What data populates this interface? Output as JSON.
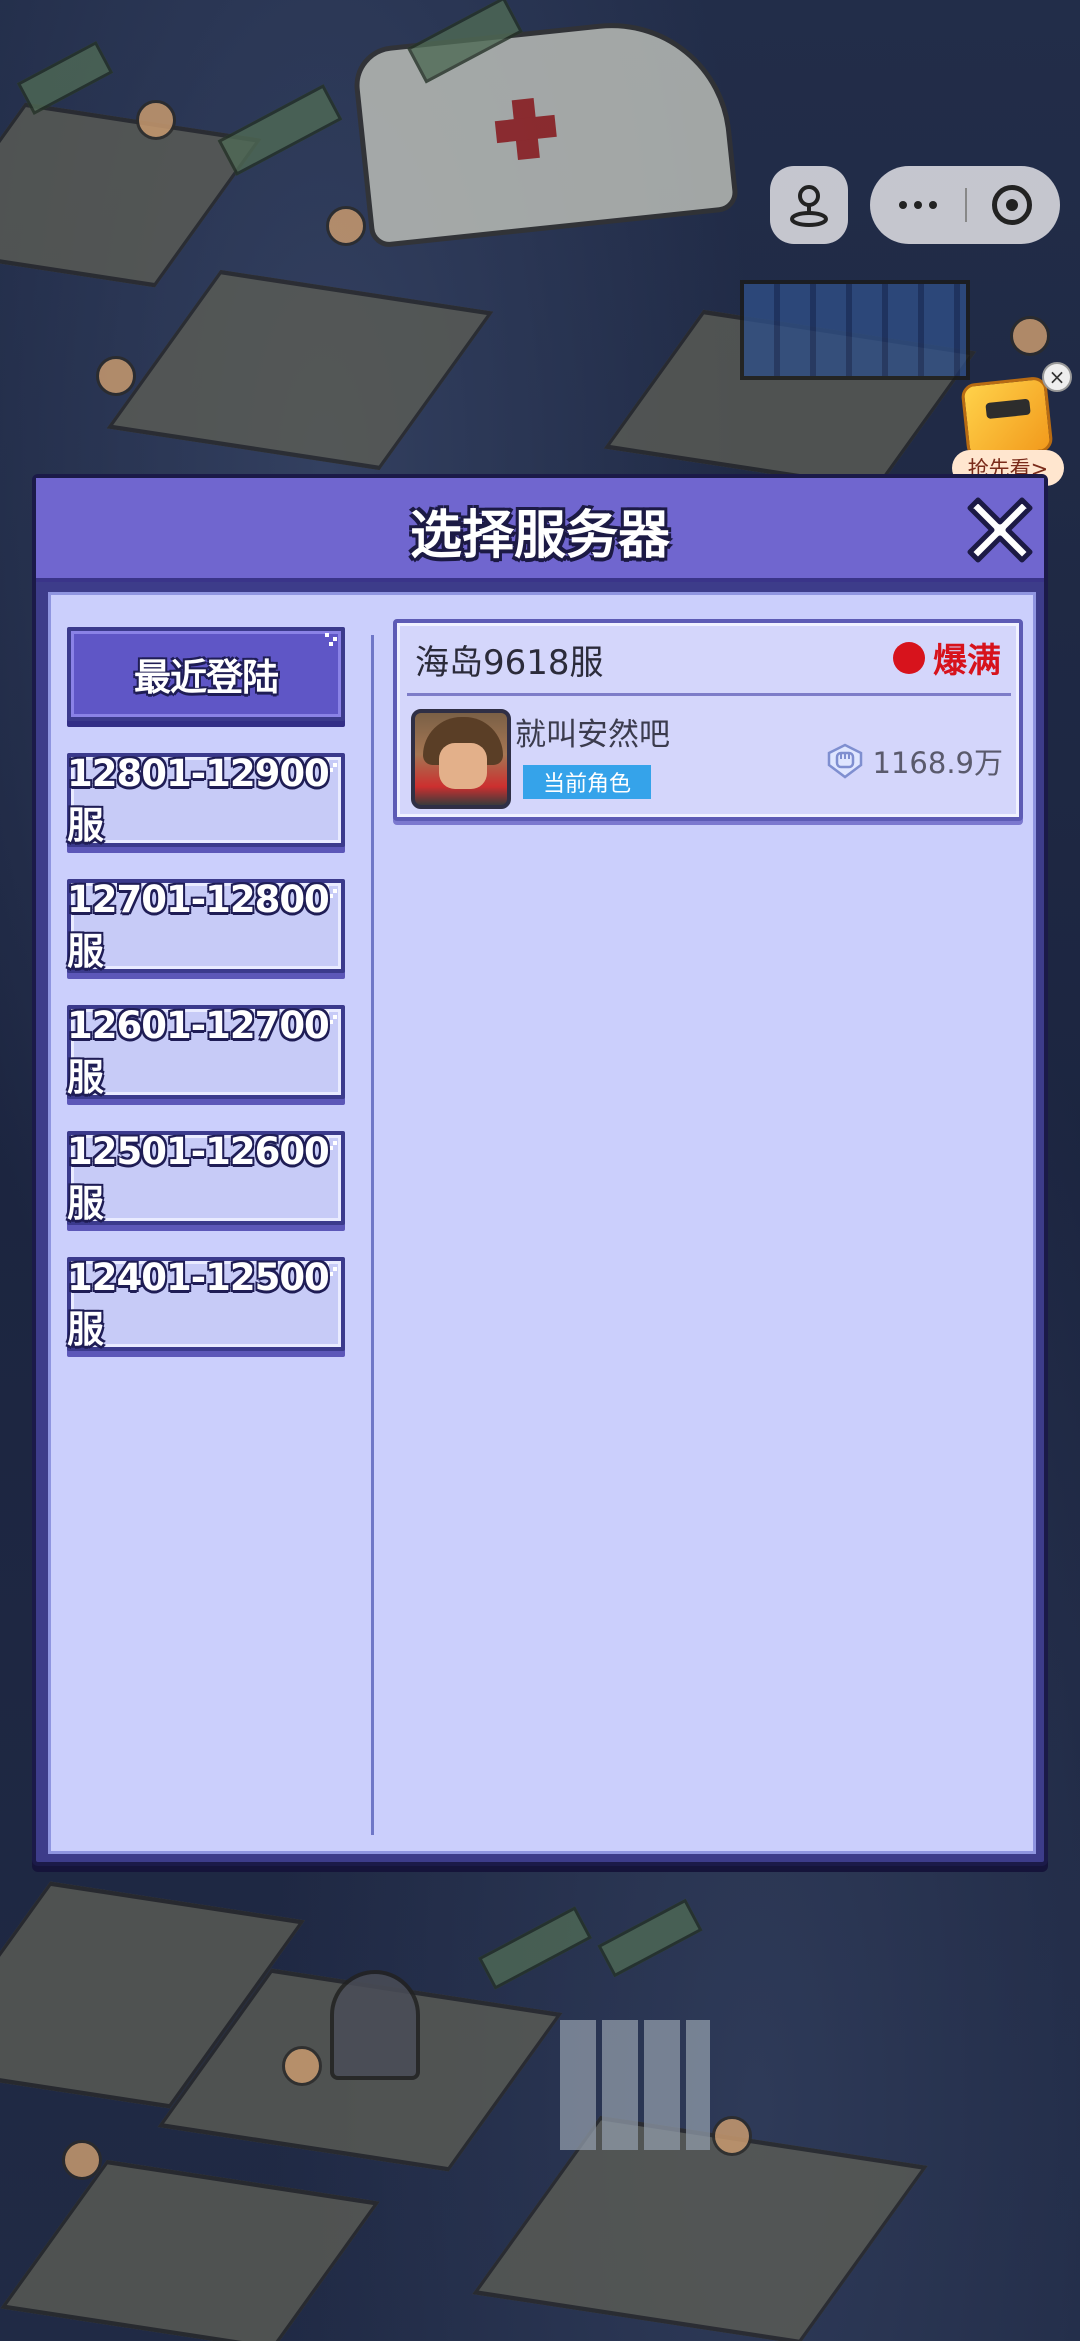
{
  "capsule": {
    "joystick_icon": "joystick-icon",
    "more_icon": "more-dots-icon",
    "close_icon": "target-circle-icon"
  },
  "promo": {
    "label": "抢先看>",
    "close_icon": "close-small-icon"
  },
  "dialog": {
    "title": "选择服务器",
    "close_icon": "close-x-icon",
    "ranges": [
      {
        "label": "最近登陆",
        "active": true
      },
      {
        "label": "12801-12900服",
        "active": false
      },
      {
        "label": "12701-12800服",
        "active": false
      },
      {
        "label": "12601-12700服",
        "active": false
      },
      {
        "label": "12501-12600服",
        "active": false
      },
      {
        "label": "12401-12500服",
        "active": false
      }
    ],
    "server": {
      "name": "海岛9618服",
      "status": "爆满",
      "status_color": "#d7131c",
      "character_name": "就叫安然吧",
      "role_badge": "当前角色",
      "power": "1168.9万",
      "power_icon": "fist-icon"
    }
  },
  "colors": {
    "header": "#7066cf",
    "panel": "#cbcffc",
    "active_tab": "#5f56c6",
    "badge": "#35a3ea"
  }
}
